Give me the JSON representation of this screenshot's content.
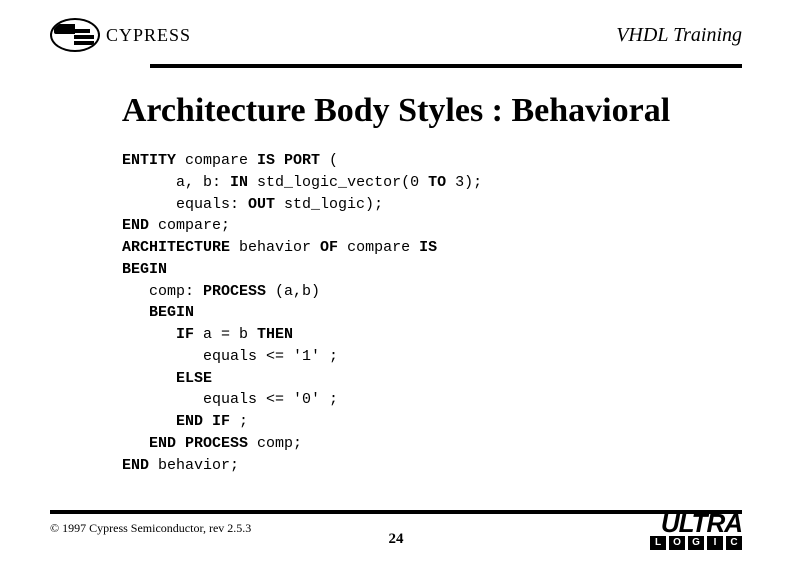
{
  "header": {
    "brand": "CYPRESS",
    "title": "VHDL Training"
  },
  "slide": {
    "title": "Architecture Body Styles : Behavioral"
  },
  "code": {
    "l1a": "ENTITY",
    "l1b": " compare ",
    "l1c": "IS PORT",
    "l1d": " (",
    "l2a": "      a, b: ",
    "l2b": "IN",
    "l2c": " std_logic_vector(0 ",
    "l2d": "TO",
    "l2e": " 3);",
    "l3a": "      equals: ",
    "l3b": "OUT",
    "l3c": " std_logic);",
    "l4a": "END",
    "l4b": " compare;",
    "l5a": "ARCHITECTURE",
    "l5b": " behavior ",
    "l5c": "OF",
    "l5d": " compare ",
    "l5e": "IS",
    "l6a": "BEGIN",
    "l7a": "   comp: ",
    "l7b": "PROCESS",
    "l7c": " (a,b)",
    "l8a": "   BEGIN",
    "l9a": "      IF",
    "l9b": " a = b ",
    "l9c": "THEN",
    "l10a": "         equals <= '1' ;",
    "l11a": "      ELSE",
    "l12a": "         equals <= '0' ;",
    "l13a": "      END IF",
    "l13b": " ;",
    "l14a": "   END PROCESS",
    "l14b": " comp;",
    "l15a": "END",
    "l15b": " behavior;"
  },
  "footer": {
    "copyright": "© 1997 Cypress Semiconductor, rev 2.5.3",
    "page": "24",
    "ultra_word": "ULTRA",
    "ultra_letters": [
      "L",
      "O",
      "G",
      "I",
      "C"
    ]
  }
}
